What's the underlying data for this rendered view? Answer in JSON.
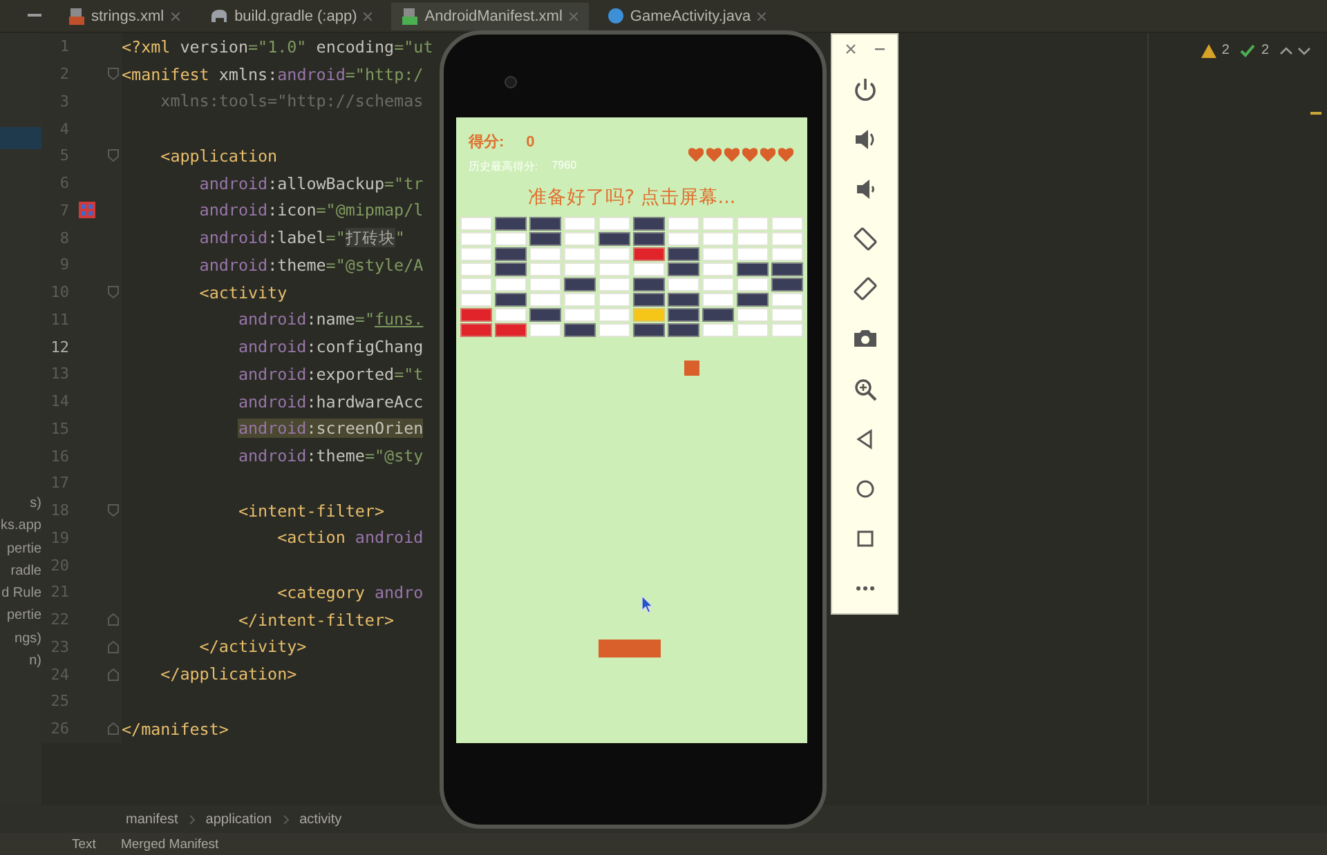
{
  "editor_tabs": [
    {
      "label": "strings.xml",
      "kind": "values",
      "selected": false
    },
    {
      "label": "build.gradle (:app)",
      "kind": "gradle",
      "selected": false
    },
    {
      "label": "AndroidManifest.xml",
      "kind": "manifest",
      "selected": true
    },
    {
      "label": "GameActivity.java",
      "kind": "class",
      "selected": false
    }
  ],
  "project_tree": [
    "s)",
    "ks.app",
    "pertie",
    "radle",
    "d Rule",
    "pertie",
    "ngs)",
    "n)"
  ],
  "inspections": {
    "warnings": "2",
    "passed": "2"
  },
  "code_lines": [
    {
      "number": "1",
      "current": false,
      "fold_start": false,
      "fold_end": false,
      "app_icon": false,
      "highlighted": false,
      "segments": [
        {
          "kind": "tag",
          "text": "<?xml"
        },
        {
          "kind": "attr",
          "text": " version"
        },
        {
          "kind": "value",
          "text": "=\"1.0\""
        },
        {
          "kind": "attr",
          "text": " encoding"
        },
        {
          "kind": "value",
          "text": "=\"ut"
        }
      ]
    },
    {
      "number": "2",
      "current": false,
      "fold_start": true,
      "fold_end": false,
      "app_icon": false,
      "highlighted": false,
      "segments": [
        {
          "kind": "tag",
          "text": "<manifest"
        },
        {
          "kind": "attr",
          "text": " xmlns:"
        },
        {
          "kind": "ns",
          "text": "android"
        },
        {
          "kind": "value",
          "text": "=\"http:/"
        }
      ]
    },
    {
      "number": "3",
      "current": false,
      "fold_start": false,
      "fold_end": false,
      "app_icon": false,
      "highlighted": false,
      "segments": [
        {
          "kind": "faded",
          "text": "    xmlns:tools=\"http://schemas"
        }
      ]
    },
    {
      "number": "4",
      "current": false,
      "fold_start": false,
      "fold_end": false,
      "app_icon": false
    },
    {
      "number": "5",
      "current": false,
      "fold_start": true,
      "fold_end": false,
      "app_icon": false,
      "highlighted": false,
      "segments": [
        {
          "kind": "tag",
          "text": "    <application"
        }
      ]
    },
    {
      "number": "6",
      "current": false,
      "fold_start": false,
      "fold_end": false,
      "app_icon": false,
      "highlighted": false,
      "segments": [
        {
          "kind": "ns",
          "text": "        android"
        },
        {
          "kind": "attr",
          "text": ":allowBackup"
        },
        {
          "kind": "value",
          "text": "=\"tr"
        }
      ]
    },
    {
      "number": "7",
      "current": false,
      "fold_start": false,
      "fold_end": false,
      "app_icon": true,
      "highlighted": false,
      "segments": [
        {
          "kind": "ns",
          "text": "        android"
        },
        {
          "kind": "attr",
          "text": ":icon"
        },
        {
          "kind": "value",
          "text": "=\"@mipmap/l"
        }
      ]
    },
    {
      "number": "8",
      "current": false,
      "fold_start": false,
      "fold_end": false,
      "app_icon": false,
      "highlighted": false,
      "segments": [
        {
          "kind": "ns",
          "text": "        android"
        },
        {
          "kind": "attr",
          "text": ":label"
        },
        {
          "kind": "value",
          "text": "=\""
        },
        {
          "kind": "folded",
          "text": "打砖块"
        },
        {
          "kind": "value",
          "text": "\""
        }
      ]
    },
    {
      "number": "9",
      "current": false,
      "fold_start": false,
      "fold_end": false,
      "app_icon": false,
      "highlighted": false,
      "segments": [
        {
          "kind": "ns",
          "text": "        android"
        },
        {
          "kind": "attr",
          "text": ":theme"
        },
        {
          "kind": "value",
          "text": "=\"@style/A"
        }
      ]
    },
    {
      "number": "10",
      "current": false,
      "fold_start": true,
      "fold_end": false,
      "app_icon": false,
      "highlighted": false,
      "segments": [
        {
          "kind": "tag",
          "text": "        <activity"
        }
      ]
    },
    {
      "number": "11",
      "current": false,
      "fold_start": false,
      "fold_end": false,
      "app_icon": false,
      "highlighted": false,
      "segments": [
        {
          "kind": "ns",
          "text": "            android"
        },
        {
          "kind": "attr",
          "text": ":name"
        },
        {
          "kind": "value",
          "text": "=\""
        },
        {
          "kind": "link",
          "text": "funs."
        }
      ]
    },
    {
      "number": "12",
      "current": true,
      "fold_start": false,
      "fold_end": false,
      "app_icon": false,
      "highlighted": false,
      "segments": [
        {
          "kind": "ns",
          "text": "            android"
        },
        {
          "kind": "attr",
          "text": ":configChang"
        }
      ]
    },
    {
      "number": "13",
      "current": false,
      "fold_start": false,
      "fold_end": false,
      "app_icon": false,
      "highlighted": false,
      "segments": [
        {
          "kind": "ns",
          "text": "            android"
        },
        {
          "kind": "attr",
          "text": ":exported"
        },
        {
          "kind": "value",
          "text": "=\"t"
        }
      ]
    },
    {
      "number": "14",
      "current": false,
      "fold_start": false,
      "fold_end": false,
      "app_icon": false,
      "highlighted": false,
      "segments": [
        {
          "kind": "ns",
          "text": "            android"
        },
        {
          "kind": "attr",
          "text": ":hardwareAcc"
        }
      ]
    },
    {
      "number": "15",
      "current": false,
      "fold_start": false,
      "fold_end": false,
      "app_icon": false,
      "highlighted": true,
      "segments": [
        {
          "kind": "ns",
          "text": "            android"
        },
        {
          "kind": "attr",
          "text": ":screenOrien"
        }
      ]
    },
    {
      "number": "16",
      "current": false,
      "fold_start": false,
      "fold_end": false,
      "app_icon": false,
      "highlighted": false,
      "segments": [
        {
          "kind": "ns",
          "text": "            android"
        },
        {
          "kind": "attr",
          "text": ":theme"
        },
        {
          "kind": "value",
          "text": "=\"@sty"
        }
      ]
    },
    {
      "number": "17",
      "current": false,
      "fold_start": false,
      "fold_end": false,
      "app_icon": false
    },
    {
      "number": "18",
      "current": false,
      "fold_start": true,
      "fold_end": false,
      "app_icon": false,
      "highlighted": false,
      "segments": [
        {
          "kind": "tag",
          "text": "            <intent-filter>"
        }
      ]
    },
    {
      "number": "19",
      "current": false,
      "fold_start": false,
      "fold_end": false,
      "app_icon": false,
      "highlighted": false,
      "segments": [
        {
          "kind": "tag",
          "text": "                <action"
        },
        {
          "kind": "ns",
          "text": " android"
        }
      ]
    },
    {
      "number": "20",
      "current": false,
      "fold_start": false,
      "fold_end": false,
      "app_icon": false
    },
    {
      "number": "21",
      "current": false,
      "fold_start": false,
      "fold_end": false,
      "app_icon": false,
      "highlighted": false,
      "segments": [
        {
          "kind": "tag",
          "text": "                <category"
        },
        {
          "kind": "ns",
          "text": " andro"
        }
      ]
    },
    {
      "number": "22",
      "current": false,
      "fold_start": false,
      "fold_end": true,
      "app_icon": false,
      "highlighted": false,
      "segments": [
        {
          "kind": "tag",
          "text": "            </intent-filter>"
        }
      ]
    },
    {
      "number": "23",
      "current": false,
      "fold_start": false,
      "fold_end": true,
      "app_icon": false,
      "highlighted": false,
      "segments": [
        {
          "kind": "tag",
          "text": "        </activity>"
        }
      ]
    },
    {
      "number": "24",
      "current": false,
      "fold_start": false,
      "fold_end": true,
      "app_icon": false,
      "highlighted": false,
      "segments": [
        {
          "kind": "tag",
          "text": "    </application>"
        }
      ]
    },
    {
      "number": "25",
      "current": false,
      "fold_start": false,
      "fold_end": false,
      "app_icon": false
    },
    {
      "number": "26",
      "current": false,
      "fold_start": false,
      "fold_end": true,
      "app_icon": false,
      "highlighted": false,
      "segments": [
        {
          "kind": "tag",
          "text": "</manifest>"
        }
      ]
    }
  ],
  "breadcrumb": [
    "manifest",
    "application",
    "activity"
  ],
  "bottom_tabs": [
    "Text",
    "Merged Manifest"
  ],
  "game": {
    "score_label": "得分:",
    "score": "0",
    "lives": [
      {
        "filled": true
      },
      {
        "filled": true
      },
      {
        "filled": true
      },
      {
        "filled": true
      },
      {
        "filled": true
      },
      {
        "filled": true
      }
    ],
    "best_label": "历史最高得分:",
    "best": "7960",
    "message": "准备好了吗? 点击屏幕...",
    "bricks": [
      {
        "cells": [
          {
            "color": "#ffffff"
          },
          {
            "color": "#3b3e58"
          },
          {
            "color": "#3b3e58"
          },
          {
            "color": "#ffffff"
          },
          {
            "color": "#ffffff"
          },
          {
            "color": "#3b3e58"
          },
          {
            "color": "#ffffff"
          },
          {
            "color": "#ffffff"
          },
          {
            "color": "#ffffff"
          },
          {
            "color": "#ffffff"
          }
        ]
      },
      {
        "cells": [
          {
            "color": "#ffffff"
          },
          {
            "color": "#ffffff"
          },
          {
            "color": "#3b3e58"
          },
          {
            "color": "#ffffff"
          },
          {
            "color": "#3b3e58"
          },
          {
            "color": "#3b3e58"
          },
          {
            "color": "#ffffff"
          },
          {
            "color": "#ffffff"
          },
          {
            "color": "#ffffff"
          },
          {
            "color": "#ffffff"
          }
        ]
      },
      {
        "cells": [
          {
            "color": "#ffffff"
          },
          {
            "color": "#3b3e58"
          },
          {
            "color": "#ffffff"
          },
          {
            "color": "#ffffff"
          },
          {
            "color": "#ffffff"
          },
          {
            "color": "#e0242a"
          },
          {
            "color": "#3b3e58"
          },
          {
            "color": "#ffffff"
          },
          {
            "color": "#ffffff"
          },
          {
            "color": "#ffffff"
          }
        ]
      },
      {
        "cells": [
          {
            "color": "#ffffff"
          },
          {
            "color": "#3b3e58"
          },
          {
            "color": "#ffffff"
          },
          {
            "color": "#ffffff"
          },
          {
            "color": "#ffffff"
          },
          {
            "color": "#ffffff"
          },
          {
            "color": "#3b3e58"
          },
          {
            "color": "#ffffff"
          },
          {
            "color": "#3b3e58"
          },
          {
            "color": "#3b3e58"
          }
        ]
      },
      {
        "cells": [
          {
            "color": "#ffffff"
          },
          {
            "color": "#ffffff"
          },
          {
            "color": "#ffffff"
          },
          {
            "color": "#3b3e58"
          },
          {
            "color": "#ffffff"
          },
          {
            "color": "#3b3e58"
          },
          {
            "color": "#ffffff"
          },
          {
            "color": "#ffffff"
          },
          {
            "color": "#ffffff"
          },
          {
            "color": "#3b3e58"
          }
        ]
      },
      {
        "cells": [
          {
            "color": "#ffffff"
          },
          {
            "color": "#3b3e58"
          },
          {
            "color": "#ffffff"
          },
          {
            "color": "#ffffff"
          },
          {
            "color": "#ffffff"
          },
          {
            "color": "#3b3e58"
          },
          {
            "color": "#3b3e58"
          },
          {
            "color": "#ffffff"
          },
          {
            "color": "#3b3e58"
          },
          {
            "color": "#ffffff"
          }
        ]
      },
      {
        "cells": [
          {
            "color": "#e0242a"
          },
          {
            "color": "#ffffff"
          },
          {
            "color": "#3b3e58"
          },
          {
            "color": "#ffffff"
          },
          {
            "color": "#ffffff"
          },
          {
            "color": "#f5c518"
          },
          {
            "color": "#3b3e58"
          },
          {
            "color": "#3b3e58"
          },
          {
            "color": "#ffffff"
          },
          {
            "color": "#ffffff"
          }
        ]
      },
      {
        "cells": [
          {
            "color": "#e0242a"
          },
          {
            "color": "#e0242a"
          },
          {
            "color": "#ffffff"
          },
          {
            "color": "#3b3e58"
          },
          {
            "color": "#ffffff"
          },
          {
            "color": "#3b3e58"
          },
          {
            "color": "#3b3e58"
          },
          {
            "color": "#ffffff"
          },
          {
            "color": "#ffffff"
          },
          {
            "color": "#ffffff"
          }
        ]
      }
    ]
  },
  "emulator_controls": [
    {
      "kind": "power"
    },
    {
      "kind": "volume-up"
    },
    {
      "kind": "volume-down"
    },
    {
      "kind": "rotate-left"
    },
    {
      "kind": "rotate-right"
    },
    {
      "kind": "screenshot"
    },
    {
      "kind": "zoom"
    },
    {
      "kind": "back"
    },
    {
      "kind": "home"
    },
    {
      "kind": "overview"
    },
    {
      "kind": "more"
    }
  ]
}
